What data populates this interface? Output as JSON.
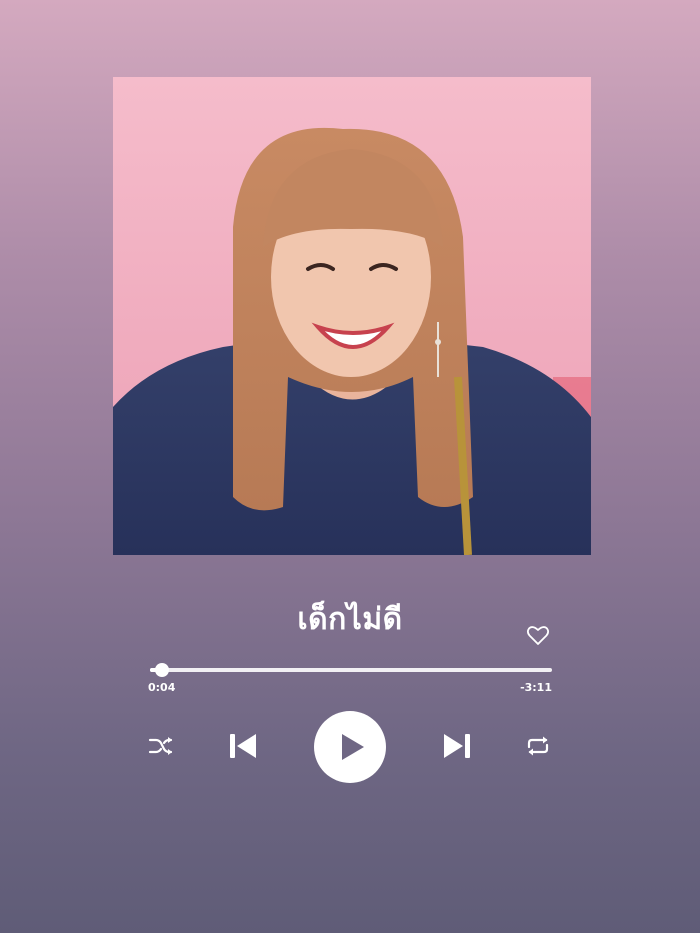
{
  "player": {
    "album_art": {
      "description_icon": "album-cover-photo"
    },
    "track": {
      "title": "เด็กไม่ดี",
      "liked": false
    },
    "progress": {
      "elapsed": "0:04",
      "remaining": "-3:11",
      "fraction": 0.03
    },
    "controls": {
      "shuffle_icon": "shuffle-icon",
      "previous_icon": "skip-previous-icon",
      "play_icon": "play-icon",
      "next_icon": "skip-next-icon",
      "repeat_icon": "repeat-icon"
    },
    "colors": {
      "background_top": "#d4a9bf",
      "background_bottom": "#5f5c77",
      "accent": "#ffffff",
      "play_glyph": "#6f6784"
    }
  }
}
